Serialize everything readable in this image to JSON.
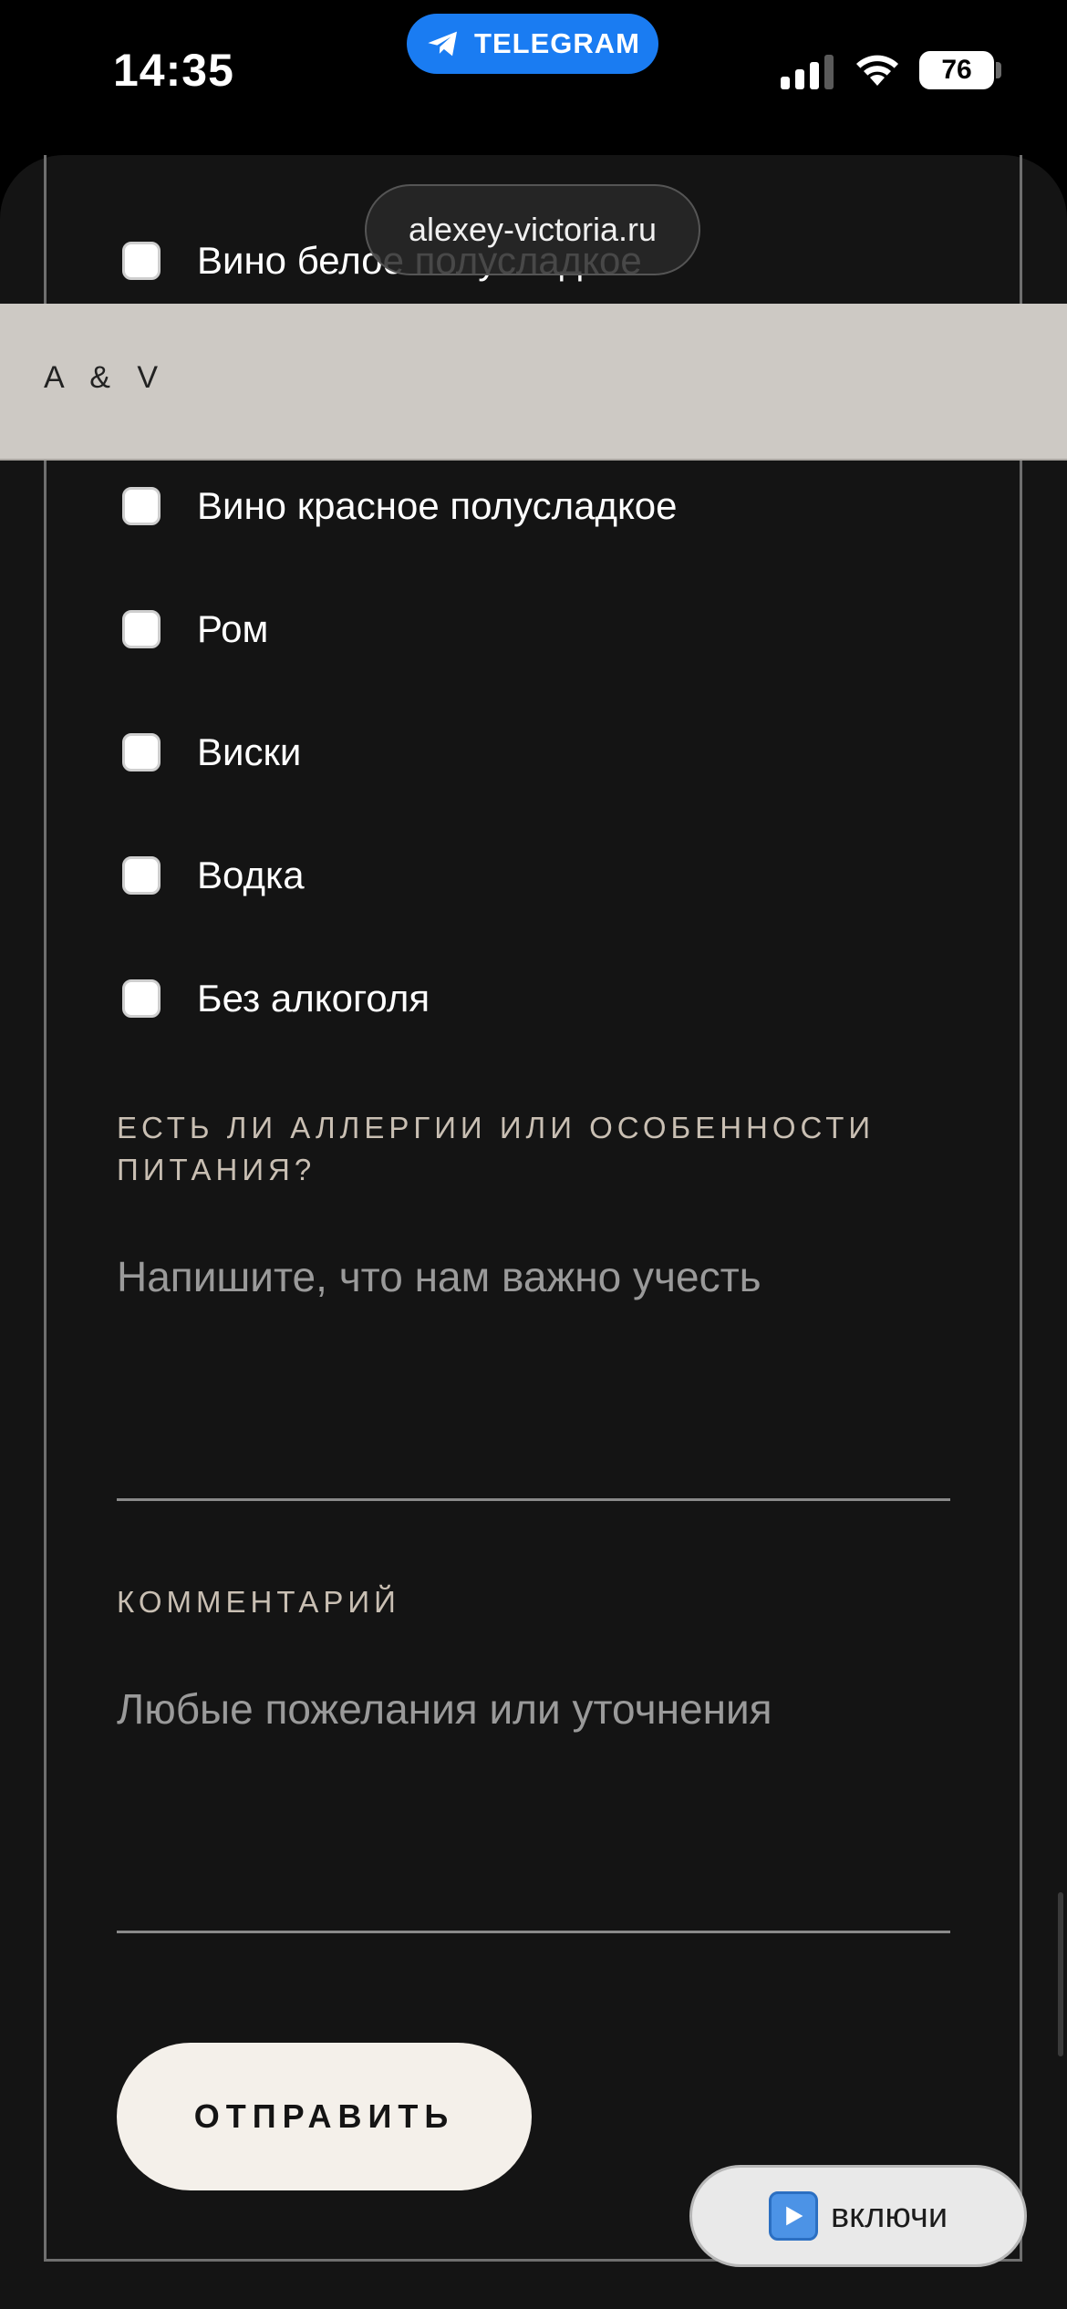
{
  "status_bar": {
    "time": "14:35",
    "app_pill": "TELEGRAM",
    "battery": "76"
  },
  "browser": {
    "url": "alexey-victoria.ru"
  },
  "header": {
    "logo": "A & V"
  },
  "drinks": {
    "options": [
      {
        "label": "Вино белое полусладкое"
      },
      {
        "label": "Вино красное полусладкое"
      },
      {
        "label": "Ром"
      },
      {
        "label": "Виски"
      },
      {
        "label": "Водка"
      },
      {
        "label": "Без алкоголя"
      }
    ]
  },
  "allergies": {
    "label": "ЕСТЬ ЛИ АЛЛЕРГИИ ИЛИ ОСОБЕННОСТИ ПИТАНИЯ?",
    "placeholder": "Напишите, что нам важно учесть"
  },
  "comment": {
    "label": "КОММЕНТАРИЙ",
    "placeholder": "Любые пожелания или уточнения"
  },
  "submit": {
    "label": "ОТПРАВИТЬ"
  },
  "music": {
    "label": "включи"
  },
  "colors": {
    "telegram_blue": "#1a7cf2",
    "page_bg": "#141414",
    "header_bg": "#cdc9c4",
    "button_bg": "#f4f0ea",
    "label_color": "#c9bfb3"
  }
}
